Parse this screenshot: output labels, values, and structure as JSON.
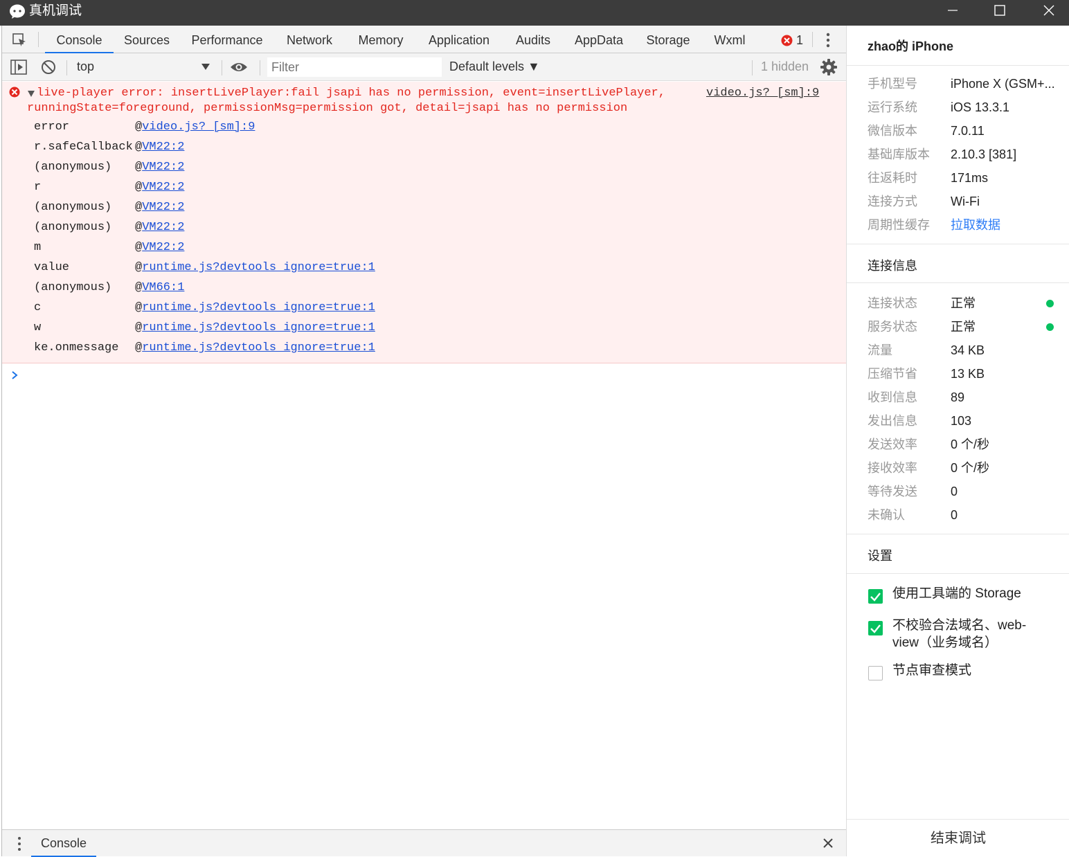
{
  "window": {
    "title": "真机调试"
  },
  "tabs": [
    "Console",
    "Sources",
    "Performance",
    "Network",
    "Memory",
    "Application",
    "Audits",
    "AppData",
    "Storage",
    "Wxml"
  ],
  "error_count": "1",
  "toolbar": {
    "context": "top",
    "filter_placeholder": "Filter",
    "levels": "Default levels ▼",
    "hidden": "1 hidden"
  },
  "error": {
    "message": "live-player error: insertLivePlayer:fail jsapi has no permission, event=insertLivePlayer, runningState=foreground, permissionMsg=permission got, detail=jsapi has no permission",
    "source": "video.js? [sm]:9",
    "stack": [
      {
        "fn": "error",
        "loc": "video.js? [sm]:9"
      },
      {
        "fn": "r.safeCallback",
        "loc": "VM22:2"
      },
      {
        "fn": "(anonymous)",
        "loc": "VM22:2"
      },
      {
        "fn": "r",
        "loc": "VM22:2"
      },
      {
        "fn": "(anonymous)",
        "loc": "VM22:2"
      },
      {
        "fn": "(anonymous)",
        "loc": "VM22:2"
      },
      {
        "fn": "m",
        "loc": "VM22:2"
      },
      {
        "fn": "value",
        "loc": "runtime.js?devtools_ignore=true:1"
      },
      {
        "fn": "(anonymous)",
        "loc": "VM66:1"
      },
      {
        "fn": "c",
        "loc": "runtime.js?devtools_ignore=true:1"
      },
      {
        "fn": "w",
        "loc": "runtime.js?devtools_ignore=true:1"
      },
      {
        "fn": "ke.onmessage",
        "loc": "runtime.js?devtools_ignore=true:1"
      }
    ]
  },
  "drawer": {
    "tab": "Console"
  },
  "device": {
    "name": "zhao的 iPhone",
    "info": [
      {
        "k": "手机型号",
        "v": "iPhone X (GSM+..."
      },
      {
        "k": "运行系统",
        "v": "iOS 13.3.1"
      },
      {
        "k": "微信版本",
        "v": "7.0.11"
      },
      {
        "k": "基础库版本",
        "v": "2.10.3 [381]"
      },
      {
        "k": "往返耗时",
        "v": "171ms"
      },
      {
        "k": "连接方式",
        "v": "Wi-Fi"
      },
      {
        "k": "周期性缓存",
        "v": "拉取数据"
      }
    ],
    "conn_title": "连接信息",
    "conn": [
      {
        "k": "连接状态",
        "v": "正常"
      },
      {
        "k": "服务状态",
        "v": "正常"
      },
      {
        "k": "流量",
        "v": "34 KB"
      },
      {
        "k": "压缩节省",
        "v": "13 KB"
      },
      {
        "k": "收到信息",
        "v": "89"
      },
      {
        "k": "发出信息",
        "v": "103"
      },
      {
        "k": "发送效率",
        "v": "0 个/秒"
      },
      {
        "k": "接收效率",
        "v": "0 个/秒"
      },
      {
        "k": "等待发送",
        "v": "0"
      },
      {
        "k": "未确认",
        "v": "0"
      }
    ],
    "settings_title": "设置",
    "settings": [
      {
        "label": "使用工具端的 Storage",
        "checked": true
      },
      {
        "label": "不校验合法域名、web-view（业务域名）",
        "checked": true
      },
      {
        "label": "节点审查模式",
        "checked": false
      }
    ],
    "end_button": "结束调试"
  },
  "colors": {
    "titlebar": "#3c3c3c",
    "error_text": "#e3271f",
    "link": "#1a4fd6",
    "accent": "#07c160"
  }
}
